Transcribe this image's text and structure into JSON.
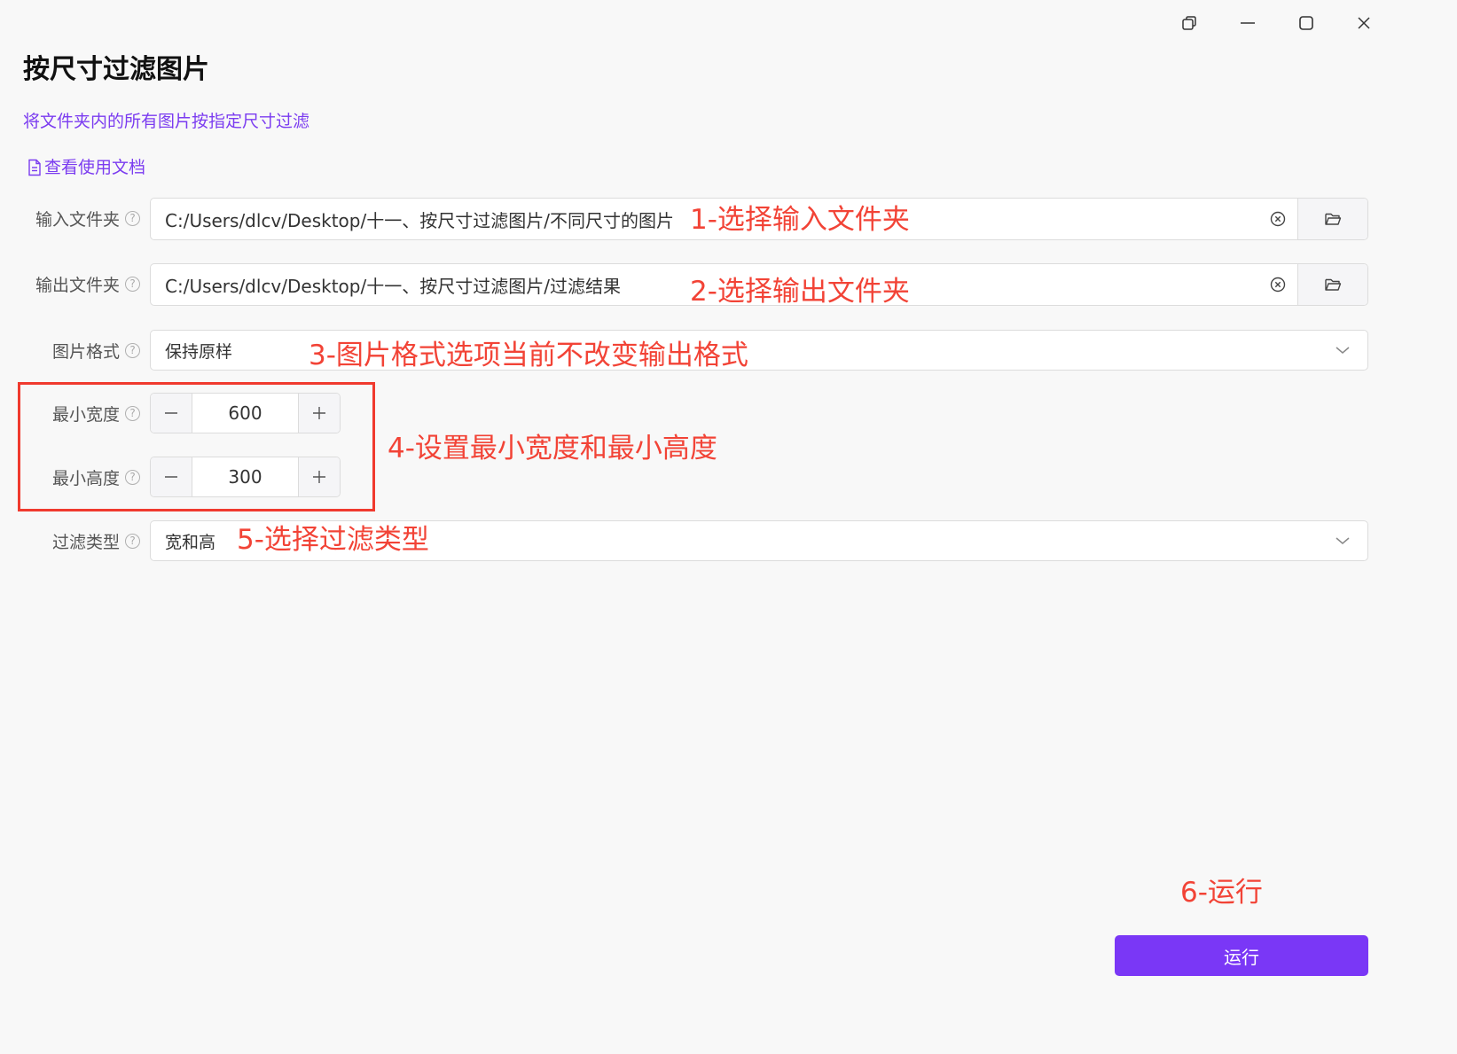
{
  "window_controls": {
    "restore_icon": "restore-window-icon",
    "minimize_icon": "minimize-icon",
    "maximize_icon": "maximize-icon",
    "close_icon": "close-icon"
  },
  "header": {
    "title": "按尺寸过滤图片",
    "subtitle": "将文件夹内的所有图片按指定尺寸过滤",
    "doc_link": "查看使用文档"
  },
  "form": {
    "input_folder": {
      "label": "输入文件夹",
      "value": "C:/Users/dlcv/Desktop/十一、按尺寸过滤图片/不同尺寸的图片"
    },
    "output_folder": {
      "label": "输出文件夹",
      "value": "C:/Users/dlcv/Desktop/十一、按尺寸过滤图片/过滤结果"
    },
    "image_format": {
      "label": "图片格式",
      "value": "保持原样"
    },
    "min_width": {
      "label": "最小宽度",
      "value": "600"
    },
    "min_height": {
      "label": "最小高度",
      "value": "300"
    },
    "filter_type": {
      "label": "过滤类型",
      "value": "宽和高"
    },
    "help_glyph": "?"
  },
  "annotations": {
    "a1": "1-选择输入文件夹",
    "a2": "2-选择输出文件夹",
    "a3": "3-图片格式选项当前不改变输出格式",
    "a4": "4-设置最小宽度和最小高度",
    "a5": "5-选择过滤类型",
    "a6": "6-运行"
  },
  "actions": {
    "run_label": "运行"
  },
  "colors": {
    "accent": "#7a37f6",
    "link": "#7b3cf0",
    "annotation": "#f24336",
    "background": "#f8f8f8"
  }
}
